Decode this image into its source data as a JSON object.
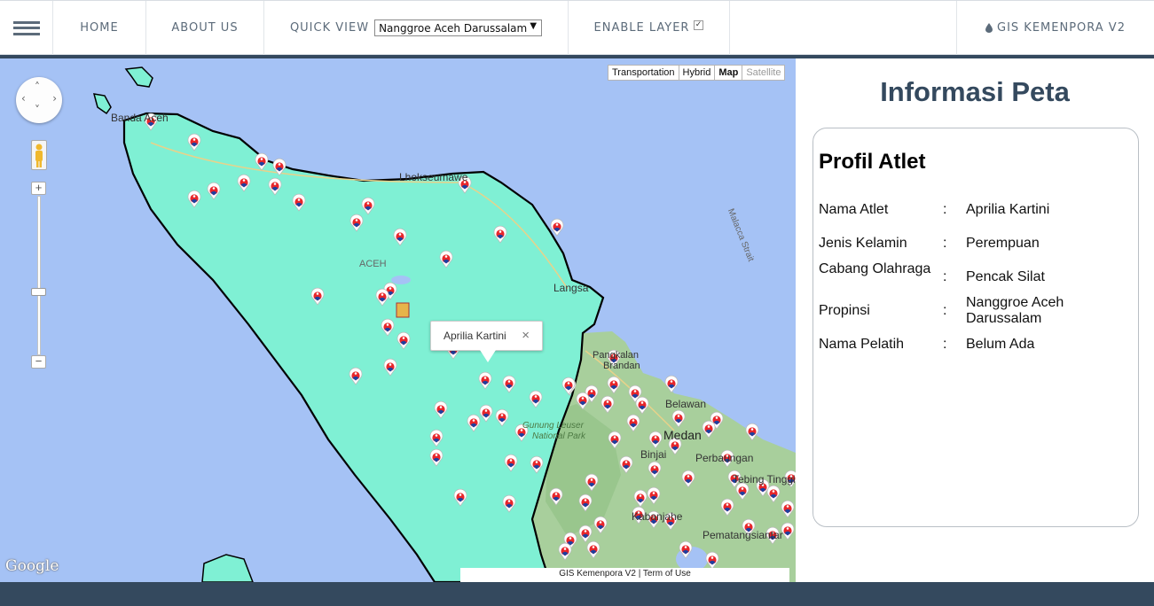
{
  "nav": {
    "home": "HOME",
    "about": "ABOUT US",
    "quick_view_label": "QUICK VIEW",
    "quick_view_selected": "Nanggroe Aceh Darussalam",
    "enable_layer": "ENABLE LAYER",
    "enable_layer_checked": true,
    "brand": "GIS KEMENPORA V2"
  },
  "map": {
    "type_buttons": [
      "Transportation",
      "Hybrid",
      "Map",
      "Satellite"
    ],
    "active_type": "Map",
    "labels": {
      "banda_aceh": "Banda Aceh",
      "lhokseumawe": "Lhokseumawe",
      "aceh": "ACEH",
      "langsa": "Langsa",
      "malacca": "Malacca Strait",
      "pangkalan": "Pangkalan",
      "brandan": "Brandan",
      "belawan": "Belawan",
      "medan": "Medan",
      "binjai": "Binjai",
      "perbaungan": "Perbaungan",
      "tebing": "Tebing Tinggi",
      "pematang": "Pematangsiantar",
      "gunung_leuser": "Gunung Leuser",
      "national_park": "National Park",
      "kabanjahe": "Kabanjahe"
    },
    "popup_text": "Aprilia Kartini",
    "popup_close": "×",
    "google": "Google",
    "attribution": "GIS Kemenpora V2 | Term of Use",
    "pan_arrows": [
      "‹",
      "›",
      "˄",
      "˅"
    ],
    "zoom_in": "+",
    "zoom_out": "−",
    "colors": {
      "water": "#a5c2f5",
      "aceh_fill": "#7ff0d4",
      "sumut_fill": "#a8cf9c",
      "border": "#000000"
    },
    "marker_icon": "kemenpora-athlete-marker-icon"
  },
  "panel": {
    "title": "Informasi Peta",
    "heading": "Profil Atlet",
    "rows": [
      {
        "label": "Nama Atlet",
        "sep": ":",
        "value": "Aprilia Kartini"
      },
      {
        "label": "Jenis Kelamin",
        "sep": ":",
        "value": "Perempuan"
      },
      {
        "label": "Cabang Olahraga",
        "sep": ":",
        "value": "Pencak Silat"
      },
      {
        "label": "Propinsi",
        "sep": ":",
        "value": "Nanggroe Aceh Darussalam"
      },
      {
        "label": "Nama Pelatih",
        "sep": ":",
        "value": "Belum Ada"
      }
    ]
  }
}
